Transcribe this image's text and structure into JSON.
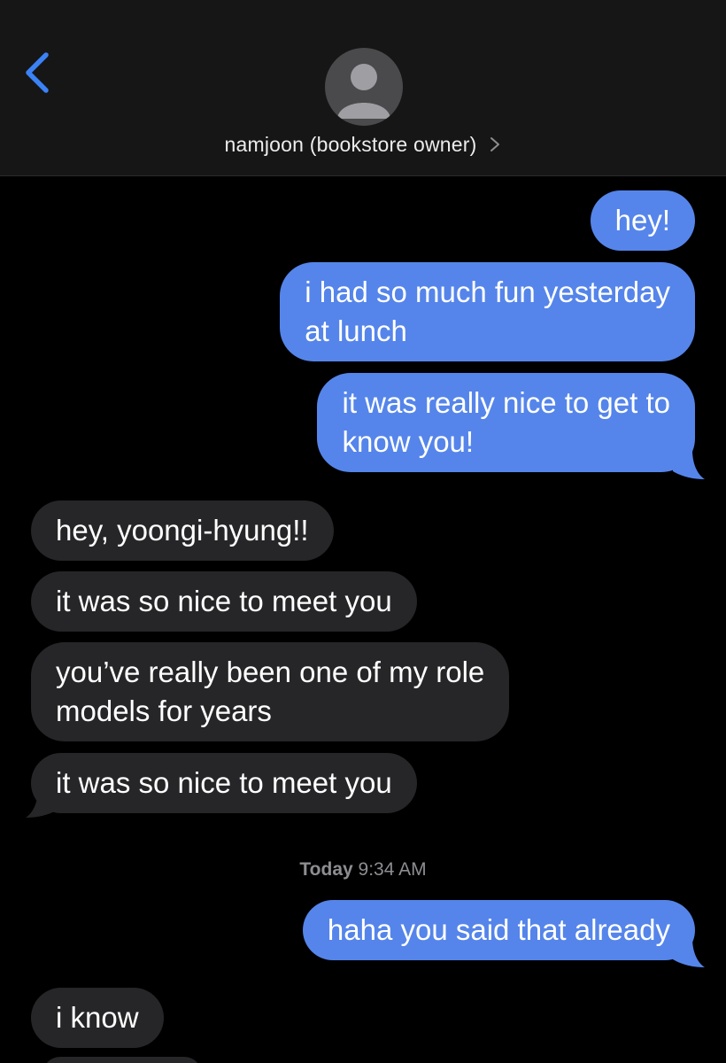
{
  "header": {
    "contact_name": "namjoon (bookstore owner)",
    "back_icon": "chevron-left-icon",
    "detail_icon": "chevron-right-icon",
    "avatar_icon": "person-silhouette-icon"
  },
  "colors": {
    "sent_bubble": "#5585ea",
    "received_bubble": "#262628",
    "header_bg": "#161616",
    "back_accent": "#3b82f6"
  },
  "messages": [
    {
      "direction": "sent",
      "lines": [
        "hey!"
      ]
    },
    {
      "direction": "sent",
      "lines": [
        "i had so much fun yesterday",
        "at lunch"
      ]
    },
    {
      "direction": "sent",
      "lines": [
        "it was really nice to get to",
        "know you!"
      ]
    },
    {
      "direction": "received",
      "lines": [
        "hey, yoongi-hyung!!"
      ]
    },
    {
      "direction": "received",
      "lines": [
        "it was so nice to meet you"
      ]
    },
    {
      "direction": "received",
      "lines": [
        "you’ve really been one of my role",
        "models for years"
      ]
    },
    {
      "direction": "received",
      "lines": [
        "it was so nice to meet you"
      ]
    },
    {
      "direction": "sent",
      "lines": [
        "haha you said that already"
      ]
    },
    {
      "direction": "received",
      "lines": [
        "i know"
      ]
    }
  ],
  "timestamp": {
    "day": "Today",
    "time": "9:34 AM"
  }
}
